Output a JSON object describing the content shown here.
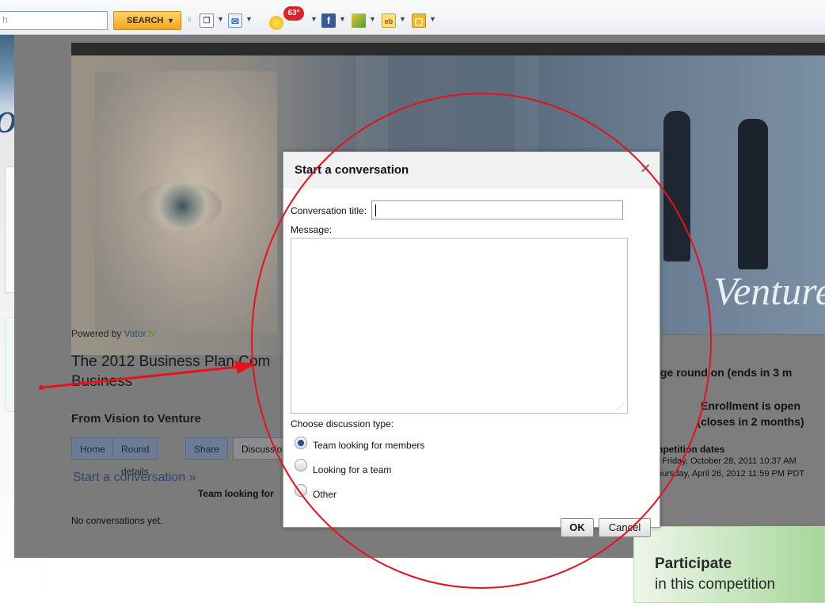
{
  "toolbar": {
    "search_placeholder": "h",
    "search_button": "SEARCH",
    "weather_badge": "63°"
  },
  "page": {
    "hero_text": "Venture",
    "powered_prefix": "Powered by ",
    "powered_brand": "Vator",
    "powered_tv": ".tv",
    "competition_title": "The 2012 Business Plan Com",
    "competition_title_line2": "Business",
    "competition_subtitle": "From Vision to Venture",
    "tabs": [
      {
        "label": "Home"
      },
      {
        "label": "Round details"
      },
      {
        "label": "Share"
      },
      {
        "label": "Discussio"
      }
    ],
    "start_conversation_link": "Start a conversation »",
    "team_looking_for": "Team looking for",
    "no_conversations": "No conversations yet."
  },
  "right_column": {
    "round_status": "lge round on (ends in 3 m",
    "enrollment": "Enrollment is open",
    "enrollment_closes": "(closes in 2 months)",
    "dates_heading": "npetition dates",
    "date_start": ": Friday, October 28, 2011 10:37 AM",
    "date_end": "hursday, April 26, 2012 11:59 PM PDT",
    "participate_title": "Participate",
    "participate_sub": "in this competition"
  },
  "dialog": {
    "title": "Start a conversation",
    "close_symbol": "×",
    "conversation_title_label": "Conversation title:",
    "conversation_title_value": "",
    "message_label": "Message:",
    "message_value": "",
    "discussion_type_label": "Choose discussion type:",
    "options": [
      {
        "label": "Team looking for members",
        "selected": true
      },
      {
        "label": "Looking for a team",
        "selected": false
      },
      {
        "label": "Other",
        "selected": false
      }
    ],
    "ok_button": "OK",
    "cancel_button": "Cancel"
  },
  "annotation_color": "#e8111b"
}
